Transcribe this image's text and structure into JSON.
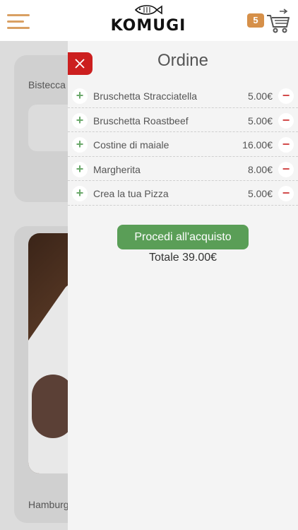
{
  "header": {
    "logo_text": "KOMUGI",
    "cart_count": "5",
    "colors": {
      "accent": "#d9a063",
      "badge": "#d69049"
    }
  },
  "background": {
    "card1_label": "Bistecca",
    "card2_label": "Hamburger"
  },
  "order": {
    "title": "Ordine",
    "items": [
      {
        "name": "Bruschetta Stracciatella",
        "price": "5.00€"
      },
      {
        "name": "Bruschetta Roastbeef",
        "price": "5.00€"
      },
      {
        "name": "Costine di maiale",
        "price": "16.00€"
      },
      {
        "name": "Margherita",
        "price": "8.00€"
      },
      {
        "name": "Crea la tua Pizza",
        "price": "5.00€"
      }
    ],
    "plus_symbol": "+",
    "minus_symbol": "−",
    "checkout_label": "Procedi all'acquisto",
    "total_label": "Totale 39.00€",
    "colors": {
      "close": "#cc1f1f",
      "checkout": "#5a9e57",
      "plus": "#6aa86a",
      "minus": "#d24a4a"
    }
  }
}
